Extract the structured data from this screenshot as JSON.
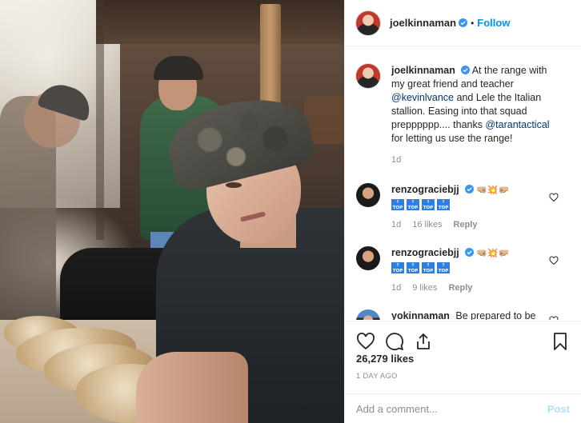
{
  "post": {
    "author": "joelkinnaman",
    "follow_label": "Follow",
    "separator": "•",
    "caption_text": "At the range with my great friend and teacher",
    "caption_mention1": "@kevinlvance",
    "caption_middle": "and Lele the Italian stallion. Easing into that squad prepppppp.... thanks",
    "caption_mention2": "@tarantactical",
    "caption_end": "for letting us use the range!",
    "caption_age": "1d",
    "likes": "26,279 likes",
    "time_ago": "1 DAY AGO"
  },
  "comments": [
    {
      "username": "renzograciebjj",
      "emoji": "🤜🏼💥🤛🏼",
      "badges": [
        "TOP",
        "TOP",
        "TOP",
        "TOP"
      ],
      "age": "1d",
      "likes": "16 likes",
      "reply": "Reply"
    },
    {
      "username": "renzograciebjj",
      "emoji": "🤜🏼💥🤛🏼",
      "badges": [
        "TOP",
        "TOP",
        "TOP",
        "TOP"
      ],
      "age": "1d",
      "likes": "9 likes",
      "reply": "Reply"
    },
    {
      "username": "yokinnaman",
      "text": "Be prepared to be"
    }
  ],
  "add_comment": {
    "placeholder": "Add a comment...",
    "post_label": "Post"
  },
  "colors": {
    "accent": "#0095f6",
    "mention": "#00376b",
    "muted": "#8e8e8e",
    "post_disabled": "#b2dffc"
  },
  "icons": [
    "verified-badge-icon",
    "heart-icon",
    "comment-icon",
    "share-icon",
    "bookmark-icon"
  ]
}
